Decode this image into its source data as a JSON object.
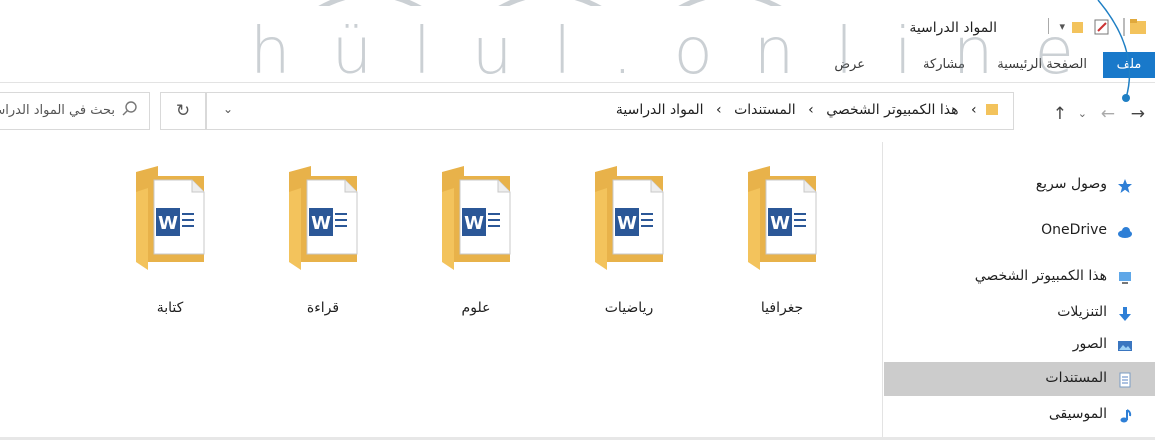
{
  "watermark": {
    "text": "hülul.online"
  },
  "window": {
    "title": "المواد الدراسية"
  },
  "ribbon": {
    "tabs": [
      {
        "label": "ملف",
        "active": true
      },
      {
        "label": "الصفحة الرئيسية",
        "active": false
      },
      {
        "label": "مشاركة",
        "active": false
      },
      {
        "label": "عرض",
        "active": false
      }
    ]
  },
  "address": {
    "breadcrumbs": [
      "هذا الكمبيوتر الشخصي",
      "المستندات",
      "المواد الدراسية"
    ]
  },
  "search": {
    "placeholder": "بحث في المواد الدراسية"
  },
  "sidebar": {
    "items": [
      {
        "label": "وصول سريع",
        "icon": "star-icon"
      },
      {
        "label": "OneDrive",
        "icon": "cloud-icon"
      },
      {
        "label": "هذا الكمبيوتر الشخصي",
        "icon": "computer-icon"
      },
      {
        "label": "التنزيلات",
        "icon": "download-icon"
      },
      {
        "label": "الصور",
        "icon": "pictures-icon"
      },
      {
        "label": "المستندات",
        "icon": "documents-icon",
        "selected": true
      },
      {
        "label": "الموسيقى",
        "icon": "music-icon"
      }
    ]
  },
  "folders": [
    {
      "name": "جغرافيا"
    },
    {
      "name": "رياضيات"
    },
    {
      "name": "علوم"
    },
    {
      "name": "قراءة"
    },
    {
      "name": "كتابة"
    }
  ],
  "colors": {
    "accent": "#1979ca",
    "folder": "#f3c35c",
    "word": "#2b5797",
    "selected": "#cccccc"
  }
}
